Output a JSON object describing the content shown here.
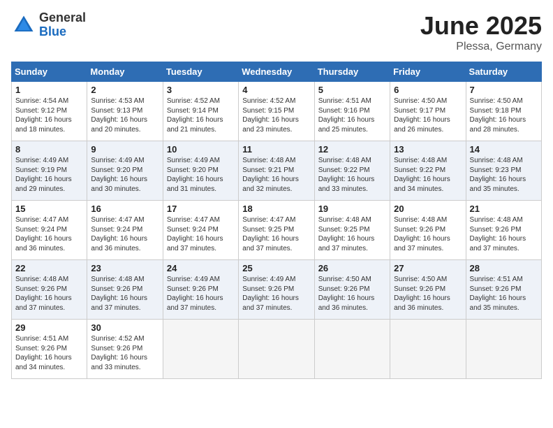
{
  "header": {
    "logo_general": "General",
    "logo_blue": "Blue",
    "month_title": "June 2025",
    "location": "Plessa, Germany"
  },
  "columns": [
    "Sunday",
    "Monday",
    "Tuesday",
    "Wednesday",
    "Thursday",
    "Friday",
    "Saturday"
  ],
  "weeks": [
    [
      {
        "day": "1",
        "info": "Sunrise: 4:54 AM\nSunset: 9:12 PM\nDaylight: 16 hours and 18 minutes."
      },
      {
        "day": "2",
        "info": "Sunrise: 4:53 AM\nSunset: 9:13 PM\nDaylight: 16 hours and 20 minutes."
      },
      {
        "day": "3",
        "info": "Sunrise: 4:52 AM\nSunset: 9:14 PM\nDaylight: 16 hours and 21 minutes."
      },
      {
        "day": "4",
        "info": "Sunrise: 4:52 AM\nSunset: 9:15 PM\nDaylight: 16 hours and 23 minutes."
      },
      {
        "day": "5",
        "info": "Sunrise: 4:51 AM\nSunset: 9:16 PM\nDaylight: 16 hours and 25 minutes."
      },
      {
        "day": "6",
        "info": "Sunrise: 4:50 AM\nSunset: 9:17 PM\nDaylight: 16 hours and 26 minutes."
      },
      {
        "day": "7",
        "info": "Sunrise: 4:50 AM\nSunset: 9:18 PM\nDaylight: 16 hours and 28 minutes."
      }
    ],
    [
      {
        "day": "8",
        "info": "Sunrise: 4:49 AM\nSunset: 9:19 PM\nDaylight: 16 hours and 29 minutes."
      },
      {
        "day": "9",
        "info": "Sunrise: 4:49 AM\nSunset: 9:20 PM\nDaylight: 16 hours and 30 minutes."
      },
      {
        "day": "10",
        "info": "Sunrise: 4:49 AM\nSunset: 9:20 PM\nDaylight: 16 hours and 31 minutes."
      },
      {
        "day": "11",
        "info": "Sunrise: 4:48 AM\nSunset: 9:21 PM\nDaylight: 16 hours and 32 minutes."
      },
      {
        "day": "12",
        "info": "Sunrise: 4:48 AM\nSunset: 9:22 PM\nDaylight: 16 hours and 33 minutes."
      },
      {
        "day": "13",
        "info": "Sunrise: 4:48 AM\nSunset: 9:22 PM\nDaylight: 16 hours and 34 minutes."
      },
      {
        "day": "14",
        "info": "Sunrise: 4:48 AM\nSunset: 9:23 PM\nDaylight: 16 hours and 35 minutes."
      }
    ],
    [
      {
        "day": "15",
        "info": "Sunrise: 4:47 AM\nSunset: 9:24 PM\nDaylight: 16 hours and 36 minutes."
      },
      {
        "day": "16",
        "info": "Sunrise: 4:47 AM\nSunset: 9:24 PM\nDaylight: 16 hours and 36 minutes."
      },
      {
        "day": "17",
        "info": "Sunrise: 4:47 AM\nSunset: 9:24 PM\nDaylight: 16 hours and 37 minutes."
      },
      {
        "day": "18",
        "info": "Sunrise: 4:47 AM\nSunset: 9:25 PM\nDaylight: 16 hours and 37 minutes."
      },
      {
        "day": "19",
        "info": "Sunrise: 4:48 AM\nSunset: 9:25 PM\nDaylight: 16 hours and 37 minutes."
      },
      {
        "day": "20",
        "info": "Sunrise: 4:48 AM\nSunset: 9:26 PM\nDaylight: 16 hours and 37 minutes."
      },
      {
        "day": "21",
        "info": "Sunrise: 4:48 AM\nSunset: 9:26 PM\nDaylight: 16 hours and 37 minutes."
      }
    ],
    [
      {
        "day": "22",
        "info": "Sunrise: 4:48 AM\nSunset: 9:26 PM\nDaylight: 16 hours and 37 minutes."
      },
      {
        "day": "23",
        "info": "Sunrise: 4:48 AM\nSunset: 9:26 PM\nDaylight: 16 hours and 37 minutes."
      },
      {
        "day": "24",
        "info": "Sunrise: 4:49 AM\nSunset: 9:26 PM\nDaylight: 16 hours and 37 minutes."
      },
      {
        "day": "25",
        "info": "Sunrise: 4:49 AM\nSunset: 9:26 PM\nDaylight: 16 hours and 37 minutes."
      },
      {
        "day": "26",
        "info": "Sunrise: 4:50 AM\nSunset: 9:26 PM\nDaylight: 16 hours and 36 minutes."
      },
      {
        "day": "27",
        "info": "Sunrise: 4:50 AM\nSunset: 9:26 PM\nDaylight: 16 hours and 36 minutes."
      },
      {
        "day": "28",
        "info": "Sunrise: 4:51 AM\nSunset: 9:26 PM\nDaylight: 16 hours and 35 minutes."
      }
    ],
    [
      {
        "day": "29",
        "info": "Sunrise: 4:51 AM\nSunset: 9:26 PM\nDaylight: 16 hours and 34 minutes."
      },
      {
        "day": "30",
        "info": "Sunrise: 4:52 AM\nSunset: 9:26 PM\nDaylight: 16 hours and 33 minutes."
      },
      {
        "day": "",
        "info": ""
      },
      {
        "day": "",
        "info": ""
      },
      {
        "day": "",
        "info": ""
      },
      {
        "day": "",
        "info": ""
      },
      {
        "day": "",
        "info": ""
      }
    ]
  ]
}
